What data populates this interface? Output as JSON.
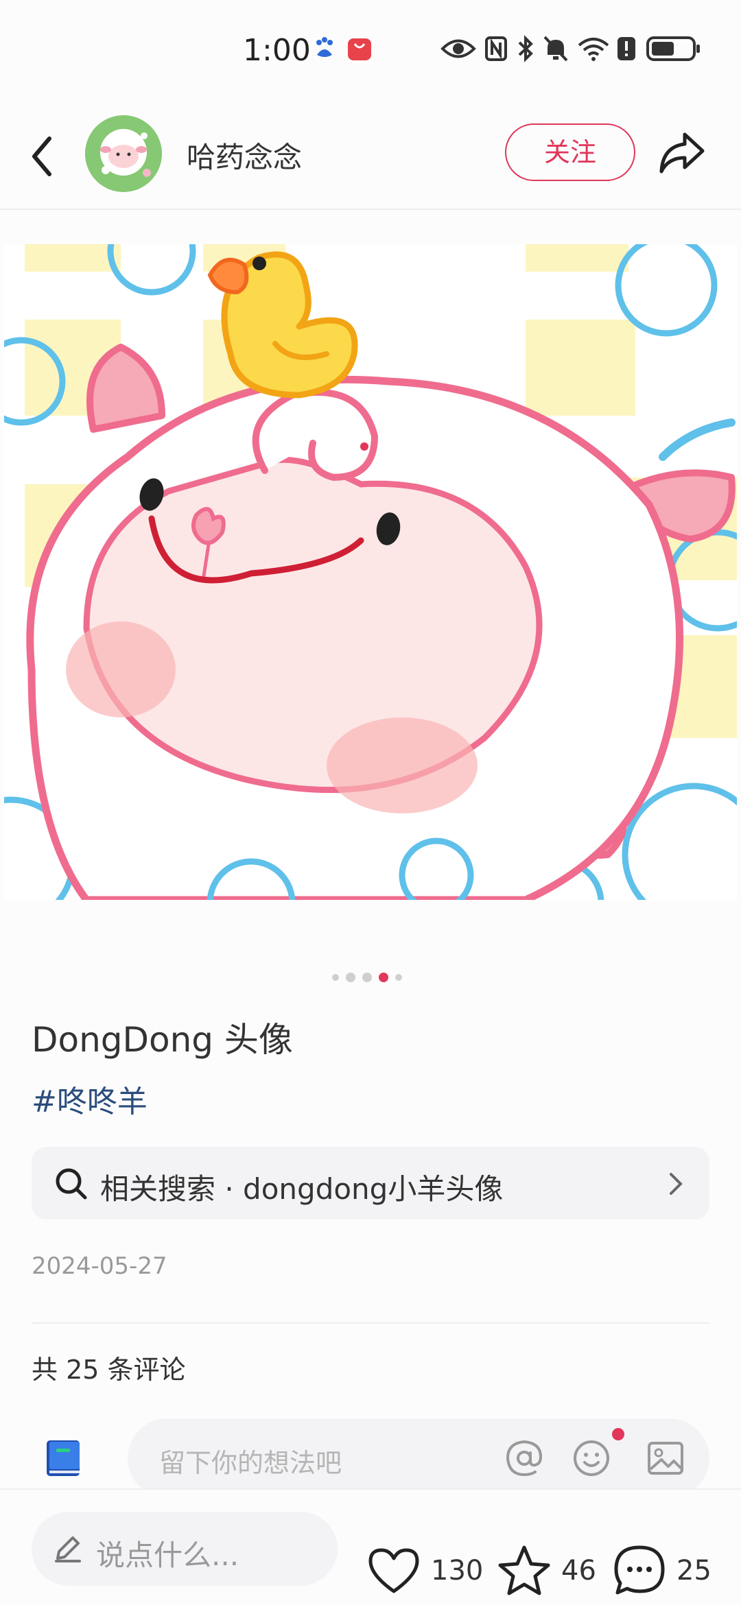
{
  "status_bar": {
    "time": "1:00",
    "icons": [
      "baidu-icon",
      "huawei-store-icon",
      "eye-icon",
      "nfc-icon",
      "bluetooth-icon",
      "mute-icon",
      "wifi-icon",
      "alert-icon",
      "battery-icon"
    ]
  },
  "header": {
    "author_name": "哈药念念",
    "follow_label": "关注"
  },
  "post": {
    "image_count": 5,
    "active_image": 4,
    "title": "DongDong 头像",
    "tag": "#咚咚羊",
    "related_search": "相关搜索 · dongdong小羊头像",
    "date": "2024-05-27"
  },
  "comments": {
    "count_label": "共 25 条评论",
    "input_placeholder": "留下你的想法吧"
  },
  "bottom_bar": {
    "say_placeholder": "说点什么...",
    "likes": "130",
    "favorites": "46",
    "comments": "25"
  },
  "colors": {
    "accent": "#e0375a",
    "tag": "#2a4d7c",
    "sheep_pink": "#ef6c8e",
    "duck_yellow": "#fbd94a",
    "bubble_blue": "#5fc0ea",
    "tile_yellow": "#fdf5bf"
  }
}
